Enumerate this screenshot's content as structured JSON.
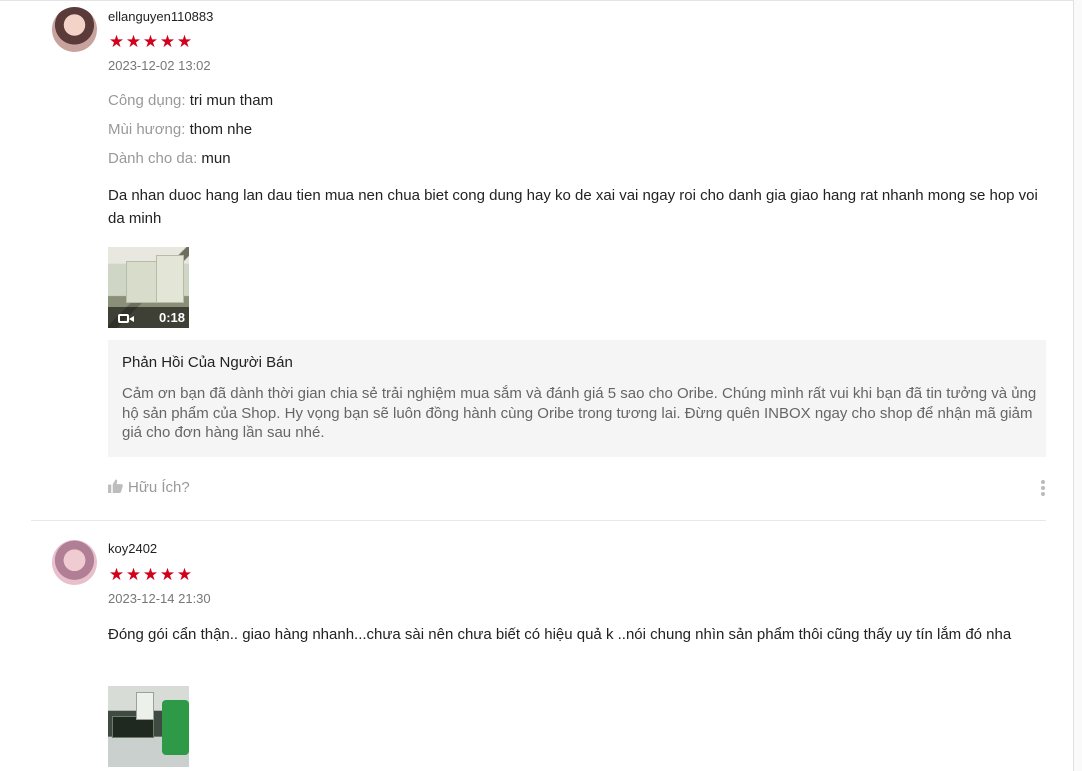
{
  "reviews": [
    {
      "username": "ellanguyen110883",
      "rating": 5,
      "date": "2023-12-02 13:02",
      "attributes": [
        {
          "key": "Công dụng:",
          "value": "tri mun tham"
        },
        {
          "key": "Mùi hương:",
          "value": "thom nhe"
        },
        {
          "key": "Dành cho da:",
          "value": "mun"
        }
      ],
      "text": "Da nhan duoc hang lan dau tien mua nen chua biet cong dung hay ko de xai vai ngay roi cho danh gia giao hang rat nhanh mong se hop voi da minh",
      "media": {
        "type": "video",
        "duration": "0:18",
        "icon": "video-camera-icon"
      },
      "seller_reply": {
        "title": "Phản Hồi Của Người Bán",
        "text": "Cảm ơn bạn đã dành thời gian chia sẻ trải nghiệm mua sắm và đánh giá 5 sao cho Oribe. Chúng mình rất vui khi bạn đã tin tưởng và ủng hộ sản phẩm của Shop. Hy vọng bạn sẽ luôn đồng hành cùng Oribe trong tương lai. Đừng quên INBOX ngay cho shop để nhận mã giảm giá cho đơn hàng lần sau nhé."
      },
      "helpful_label": "Hữu Ích?"
    },
    {
      "username": "koy2402",
      "rating": 5,
      "date": "2023-12-14 21:30",
      "text": "Đóng gói cẩn thận.. giao hàng nhanh...chưa sài nên chưa biết có hiệu quả k ..nói chung nhìn sản phẩm thôi cũng thấy uy tín lắm đó nha",
      "media": {
        "type": "image"
      }
    }
  ],
  "colors": {
    "star": "#d0011b",
    "muted": "#999999",
    "reply_bg": "#f5f5f5"
  }
}
